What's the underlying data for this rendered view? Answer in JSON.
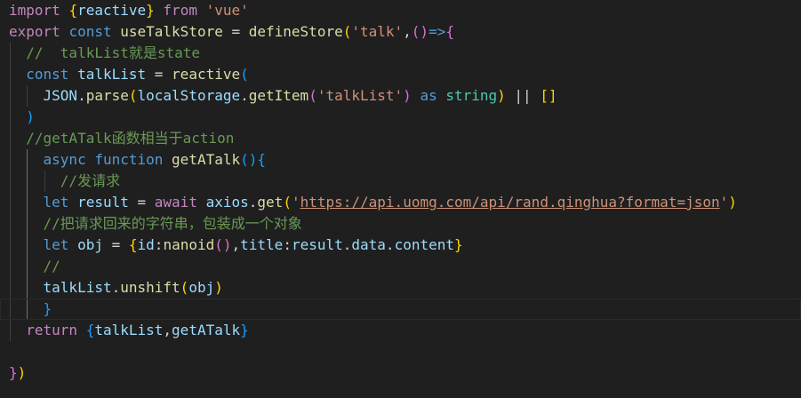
{
  "editor": {
    "language": "javascript",
    "theme": "dark",
    "lines": [
      [
        [
          "import",
          "kw"
        ],
        [
          " ",
          "p"
        ],
        [
          "{",
          "b1"
        ],
        [
          "reactive",
          "var"
        ],
        [
          "}",
          "b1"
        ],
        [
          " ",
          "p"
        ],
        [
          "from",
          "kw"
        ],
        [
          " ",
          "p"
        ],
        [
          "'vue'",
          "str"
        ]
      ],
      [
        [
          "export",
          "kw"
        ],
        [
          " ",
          "p"
        ],
        [
          "const",
          "kw2"
        ],
        [
          " ",
          "p"
        ],
        [
          "useTalkStore",
          "fn"
        ],
        [
          " = ",
          "p"
        ],
        [
          "defineStore",
          "fn"
        ],
        [
          "(",
          "b1"
        ],
        [
          "'talk'",
          "str"
        ],
        [
          ",",
          "p"
        ],
        [
          "()",
          "b2"
        ],
        [
          "=>",
          "kw2"
        ],
        [
          "{",
          "b2"
        ]
      ],
      [
        [
          "  //  talkList就是state",
          "cm"
        ]
      ],
      [
        [
          "  ",
          "p"
        ],
        [
          "const",
          "kw2"
        ],
        [
          " ",
          "p"
        ],
        [
          "talkList",
          "var"
        ],
        [
          " = ",
          "p"
        ],
        [
          "reactive",
          "fn"
        ],
        [
          "(",
          "b3"
        ]
      ],
      [
        [
          "    ",
          "p"
        ],
        [
          "JSON",
          "var"
        ],
        [
          ".",
          "p"
        ],
        [
          "parse",
          "fn"
        ],
        [
          "(",
          "b1"
        ],
        [
          "localStorage",
          "var"
        ],
        [
          ".",
          "p"
        ],
        [
          "getItem",
          "fn"
        ],
        [
          "(",
          "b2"
        ],
        [
          "'talkList'",
          "str"
        ],
        [
          ")",
          "b2"
        ],
        [
          " ",
          "p"
        ],
        [
          "as",
          "kw2"
        ],
        [
          " ",
          "p"
        ],
        [
          "string",
          "cls"
        ],
        [
          ")",
          "b1"
        ],
        [
          " || ",
          "p"
        ],
        [
          "[]",
          "b1"
        ]
      ],
      [
        [
          "  ",
          "p"
        ],
        [
          ")",
          "b3"
        ]
      ],
      [
        [
          "  //getATalk函数相当于action",
          "cm"
        ]
      ],
      [
        [
          "    ",
          "p"
        ],
        [
          "async",
          "kw2"
        ],
        [
          " ",
          "p"
        ],
        [
          "function",
          "kw2"
        ],
        [
          " ",
          "p"
        ],
        [
          "getATalk",
          "fn"
        ],
        [
          "()",
          "b3"
        ],
        [
          "{",
          "b3"
        ]
      ],
      [
        [
          "      //发请求",
          "cm"
        ]
      ],
      [
        [
          "    ",
          "p"
        ],
        [
          "let",
          "kw2"
        ],
        [
          " ",
          "p"
        ],
        [
          "result",
          "var"
        ],
        [
          " = ",
          "p"
        ],
        [
          "await",
          "kw"
        ],
        [
          " ",
          "p"
        ],
        [
          "axios",
          "var"
        ],
        [
          ".",
          "p"
        ],
        [
          "get",
          "fn"
        ],
        [
          "(",
          "b1"
        ],
        [
          "'",
          "str"
        ],
        [
          "https://api.uomg.com/api/rand.qinghua?format=json",
          "str link"
        ],
        [
          "'",
          "str"
        ],
        [
          ")",
          "b1"
        ]
      ],
      [
        [
          "    //把请求回来的字符串，包装成一个对象",
          "cm"
        ]
      ],
      [
        [
          "    ",
          "p"
        ],
        [
          "let",
          "kw2"
        ],
        [
          " ",
          "p"
        ],
        [
          "obj",
          "var"
        ],
        [
          " = ",
          "p"
        ],
        [
          "{",
          "b1"
        ],
        [
          "id",
          "var"
        ],
        [
          ":",
          "p"
        ],
        [
          "nanoid",
          "fn"
        ],
        [
          "()",
          "b2"
        ],
        [
          ",",
          "p"
        ],
        [
          "title",
          "var"
        ],
        [
          ":",
          "p"
        ],
        [
          "result",
          "var"
        ],
        [
          ".",
          "p"
        ],
        [
          "data",
          "var"
        ],
        [
          ".",
          "p"
        ],
        [
          "content",
          "var"
        ],
        [
          "}",
          "b1"
        ]
      ],
      [
        [
          "    //",
          "cm"
        ]
      ],
      [
        [
          "    ",
          "p"
        ],
        [
          "talkList",
          "var"
        ],
        [
          ".",
          "p"
        ],
        [
          "unshift",
          "fn"
        ],
        [
          "(",
          "b1"
        ],
        [
          "obj",
          "var"
        ],
        [
          ")",
          "b1"
        ]
      ],
      [
        [
          "    ",
          "p"
        ],
        [
          "}",
          "b3"
        ]
      ],
      [
        [
          "  ",
          "p"
        ],
        [
          "return",
          "kw"
        ],
        [
          " ",
          "p"
        ],
        [
          "{",
          "b3"
        ],
        [
          "talkList",
          "var"
        ],
        [
          ",",
          "p"
        ],
        [
          "getATalk",
          "var"
        ],
        [
          "}",
          "b3"
        ]
      ],
      [],
      [
        [
          "}",
          "b2"
        ],
        [
          ")",
          "b1"
        ]
      ]
    ]
  }
}
